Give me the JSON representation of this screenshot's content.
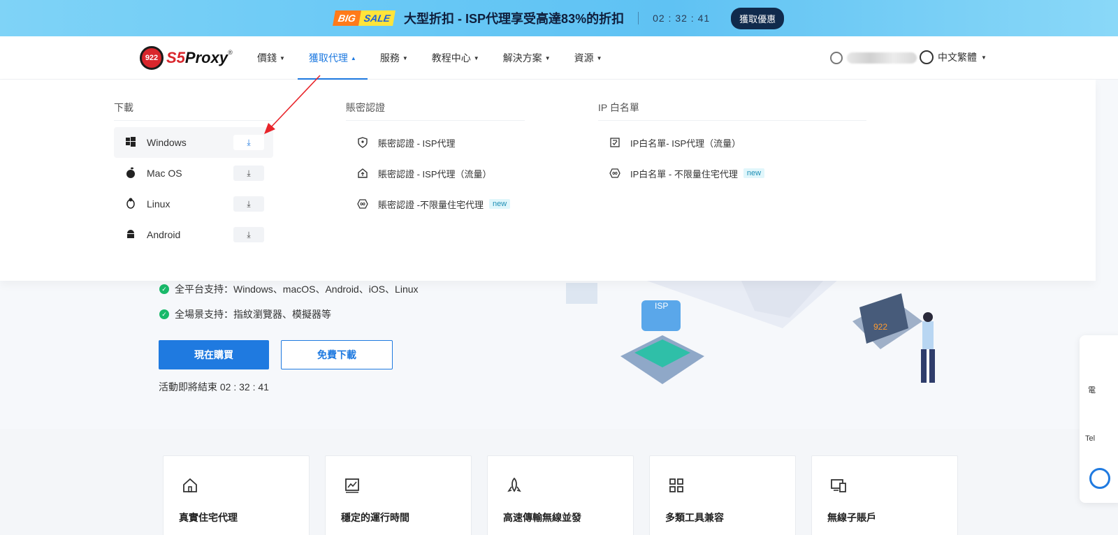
{
  "promo": {
    "big": "BIG",
    "sale": "SALE",
    "text": "大型折扣 - ISP代理享受高達83%的折扣",
    "timer": "02 : 32 : 41",
    "button": "獲取優惠"
  },
  "nav": {
    "logo_badge": "922",
    "logo_s5": "S5",
    "logo_proxy": "Proxy",
    "logo_reg": "®",
    "items": [
      {
        "label": "價錢"
      },
      {
        "label": "獲取代理"
      },
      {
        "label": "服務"
      },
      {
        "label": "教程中心"
      },
      {
        "label": "解決方案"
      },
      {
        "label": "資源"
      }
    ],
    "language": "中文繁體"
  },
  "dropdown": {
    "download_title": "下載",
    "downloads": [
      {
        "name": "Windows",
        "icon": "windows-icon"
      },
      {
        "name": "Mac OS",
        "icon": "apple-icon"
      },
      {
        "name": "Linux",
        "icon": "linux-icon"
      },
      {
        "name": "Android",
        "icon": "android-icon"
      }
    ],
    "auth_title": "賬密認證",
    "auth_items": [
      {
        "label": "賬密認證 - ISP代理",
        "badge": ""
      },
      {
        "label": "賬密認證 - ISP代理（流量）",
        "badge": ""
      },
      {
        "label": "賬密認證 -不限量住宅代理",
        "badge": "new"
      }
    ],
    "ip_title": "IP 白名單",
    "ip_items": [
      {
        "label": "IP白名單- ISP代理（流量）",
        "badge": ""
      },
      {
        "label": "IP白名單 - 不限量住宅代理",
        "badge": "new"
      }
    ]
  },
  "hero": {
    "feature1": "全平台支持：Windows、macOS、Android、iOS、Linux",
    "feature2": "全場景支持：指紋瀏覽器、模擬器等",
    "buy_button": "現在購買",
    "free_button": "免費下載",
    "countdown": "活動即將結束 02 : 32 : 41",
    "isp_label": "ISP",
    "laptop_label": "922"
  },
  "side_widget": {
    "label1": "電",
    "label2": "Tel"
  },
  "cards": [
    {
      "title": "真實住宅代理",
      "icon": "home-icon"
    },
    {
      "title": "穩定的運行時間",
      "icon": "chart-icon"
    },
    {
      "title": "高速傳輸無線並發",
      "icon": "rocket-icon"
    },
    {
      "title": "多類工具兼容",
      "icon": "grid-icon"
    },
    {
      "title": "無線子賬戶",
      "icon": "devices-icon"
    }
  ],
  "colors": {
    "accent": "#1f7ae0",
    "new_badge_bg": "#e0f6fb",
    "check_green": "#19b96a",
    "annotation_arrow": "#e8242a"
  }
}
